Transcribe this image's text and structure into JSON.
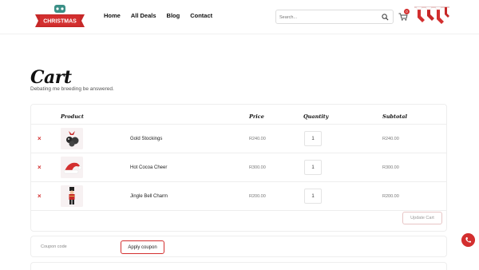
{
  "header": {
    "logo_text": "CHRISTMAS",
    "nav": [
      "Home",
      "All Deals",
      "Blog",
      "Contact"
    ],
    "search_placeholder": "Search...",
    "cart_count": "0"
  },
  "page": {
    "title": "Cart",
    "subtitle": "Debating me breeding be answered."
  },
  "cart": {
    "headers": {
      "product": "Product",
      "price": "Price",
      "quantity": "Quantity",
      "subtotal": "Subtotal"
    },
    "items": [
      {
        "name": "Gold Stockings",
        "price": "R240.00",
        "quantity": "1",
        "subtotal": "R240.00",
        "thumb": "ornament-icon"
      },
      {
        "name": "Hot Cocoa Cheer",
        "price": "R300.00",
        "quantity": "1",
        "subtotal": "R300.00",
        "thumb": "santa-hat-icon"
      },
      {
        "name": "Jingle Bell Charm",
        "price": "R200.00",
        "quantity": "1",
        "subtotal": "R200.00",
        "thumb": "nutcracker-icon"
      }
    ],
    "update_label": "Update Cart",
    "remove_symbol": "×"
  },
  "coupon": {
    "placeholder": "Coupon code",
    "apply_label": "Apply coupon"
  },
  "colors": {
    "accent": "#d32f2f"
  }
}
